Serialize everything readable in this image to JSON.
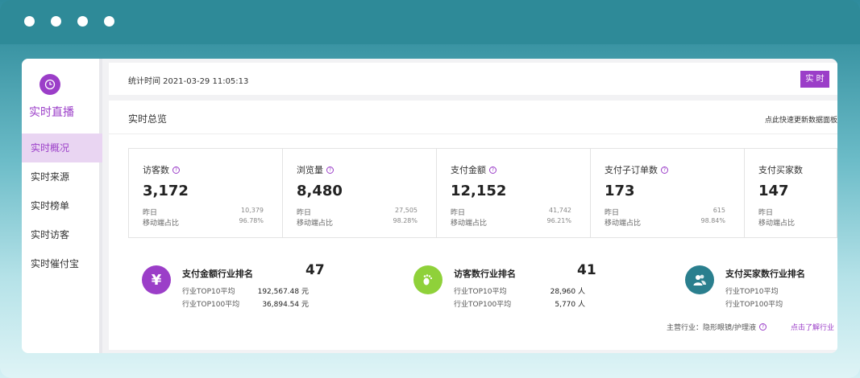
{
  "colors": {
    "accent": "#9b3ec8",
    "green": "#8fd13a",
    "teal": "#2a7f8e"
  },
  "sidebar": {
    "title": "实时直播",
    "items": [
      {
        "label": "实时概况",
        "active": true
      },
      {
        "label": "实时来源"
      },
      {
        "label": "实时榜单"
      },
      {
        "label": "实时访客"
      },
      {
        "label": "实时催付宝"
      }
    ]
  },
  "header": {
    "stat_time": "统计时间 2021-03-29 11:05:13",
    "realtime_button": "实 时"
  },
  "panel": {
    "title": "实时总览",
    "refresh_link": "点此快速更新数据面板"
  },
  "metrics": [
    {
      "label": "访客数",
      "value": "3,172",
      "yesterday_label": "昨日",
      "yesterday": "10,379",
      "mobile_label": "移动端占比",
      "mobile": "96.78%"
    },
    {
      "label": "浏览量",
      "value": "8,480",
      "yesterday_label": "昨日",
      "yesterday": "27,505",
      "mobile_label": "移动端占比",
      "mobile": "98.28%"
    },
    {
      "label": "支付金额",
      "value": "12,152",
      "yesterday_label": "昨日",
      "yesterday": "41,742",
      "mobile_label": "移动端占比",
      "mobile": "96.21%"
    },
    {
      "label": "支付子订单数",
      "value": "173",
      "yesterday_label": "昨日",
      "yesterday": "615",
      "mobile_label": "移动端占比",
      "mobile": "98.84%"
    },
    {
      "label": "支付买家数",
      "value": "147",
      "yesterday_label": "昨日",
      "yesterday": "",
      "mobile_label": "移动端占比",
      "mobile": ""
    }
  ],
  "rankings": [
    {
      "title": "支付金额行业排名",
      "rank": "47",
      "icon": "yen-icon",
      "top10_label": "行业TOP10平均",
      "top10": "192,567.48 元",
      "top100_label": "行业TOP100平均",
      "top100": "36,894.54 元"
    },
    {
      "title": "访客数行业排名",
      "rank": "41",
      "icon": "footprint-icon",
      "top10_label": "行业TOP10平均",
      "top10": "28,960 人",
      "top100_label": "行业TOP100平均",
      "top100": "5,770 人"
    },
    {
      "title": "支付买家数行业排名",
      "rank": "",
      "icon": "users-icon",
      "top10_label": "行业TOP10平均",
      "top10": "",
      "top100_label": "行业TOP100平均",
      "top100": ""
    }
  ],
  "footer": {
    "industry": "主营行业：隐形眼镜/护理液",
    "learn_more": "点击了解行业"
  }
}
